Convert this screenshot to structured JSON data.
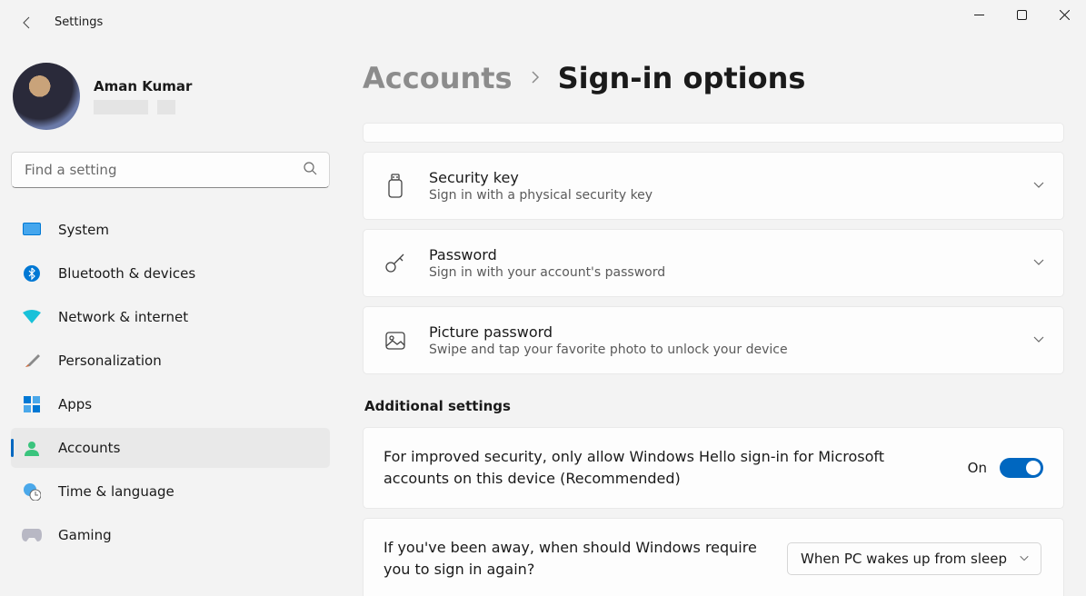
{
  "window": {
    "title": "Settings"
  },
  "profile": {
    "name": "Aman Kumar"
  },
  "search": {
    "placeholder": "Find a setting"
  },
  "nav": [
    {
      "label": "System"
    },
    {
      "label": "Bluetooth & devices"
    },
    {
      "label": "Network & internet"
    },
    {
      "label": "Personalization"
    },
    {
      "label": "Apps"
    },
    {
      "label": "Accounts"
    },
    {
      "label": "Time & language"
    },
    {
      "label": "Gaming"
    }
  ],
  "breadcrumb": {
    "parent": "Accounts",
    "current": "Sign-in options"
  },
  "options": [
    {
      "title": "Security key",
      "sub": "Sign in with a physical security key"
    },
    {
      "title": "Password",
      "sub": "Sign in with your account's password"
    },
    {
      "title": "Picture password",
      "sub": "Swipe and tap your favorite photo to unlock your device"
    }
  ],
  "sectionLabel": "Additional settings",
  "helloSetting": {
    "text": "For improved security, only allow Windows Hello sign-in for Microsoft accounts on this device (Recommended)",
    "stateLabel": "On"
  },
  "awaySetting": {
    "text": "If you've been away, when should Windows require you to sign in again?",
    "value": "When PC wakes up from sleep"
  }
}
